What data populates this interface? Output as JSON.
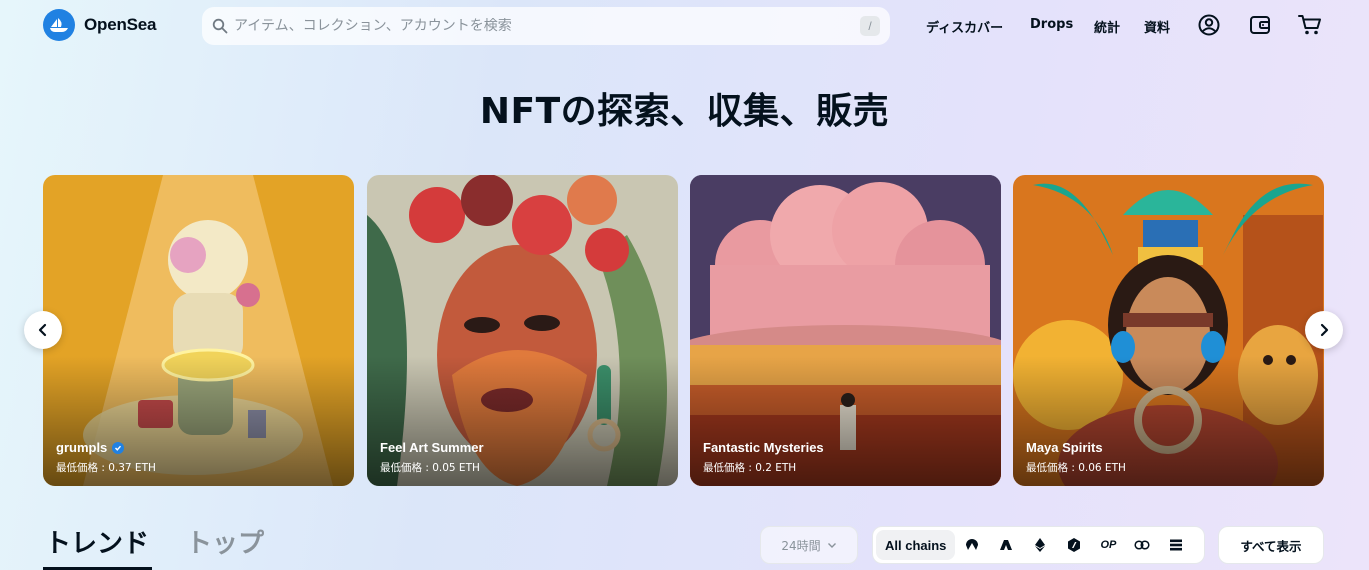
{
  "brand": {
    "name": "OpenSea",
    "accent": "#2081e2"
  },
  "search": {
    "placeholder": "アイテム、コレクション、アカウントを検索",
    "shortcut": "/"
  },
  "nav": {
    "discover": "ディスカバー",
    "drops": "Drops",
    "stats": "統計",
    "resources": "資料"
  },
  "header_icons": [
    "account-icon",
    "wallet-icon",
    "cart-icon"
  ],
  "hero": {
    "title": "NFTの探索、収集、販売"
  },
  "carousel": {
    "cards": [
      {
        "name": "grumpls",
        "verified": true,
        "price": "最低価格 : 0.37 ETH"
      },
      {
        "name": "Feel Art Summer",
        "verified": false,
        "price": "最低価格 : 0.05 ETH"
      },
      {
        "name": "Fantastic Mysteries",
        "verified": false,
        "price": "最低価格 : 0.2 ETH"
      },
      {
        "name": "Maya Spirits",
        "verified": false,
        "price": "最低価格 : 0.06 ETH"
      }
    ]
  },
  "tabs": {
    "trending": "トレンド",
    "top": "トップ"
  },
  "filters": {
    "period": "24時間",
    "all_chains": "All chains",
    "chain_icons": [
      "arbitrum-nova-icon",
      "avalanche-icon",
      "ethereum-icon",
      "arbitrum-icon",
      "optimism-icon",
      "chain-link-icon",
      "solana-icon"
    ],
    "optimism_label": "OP",
    "view_all": "すべて表示"
  }
}
